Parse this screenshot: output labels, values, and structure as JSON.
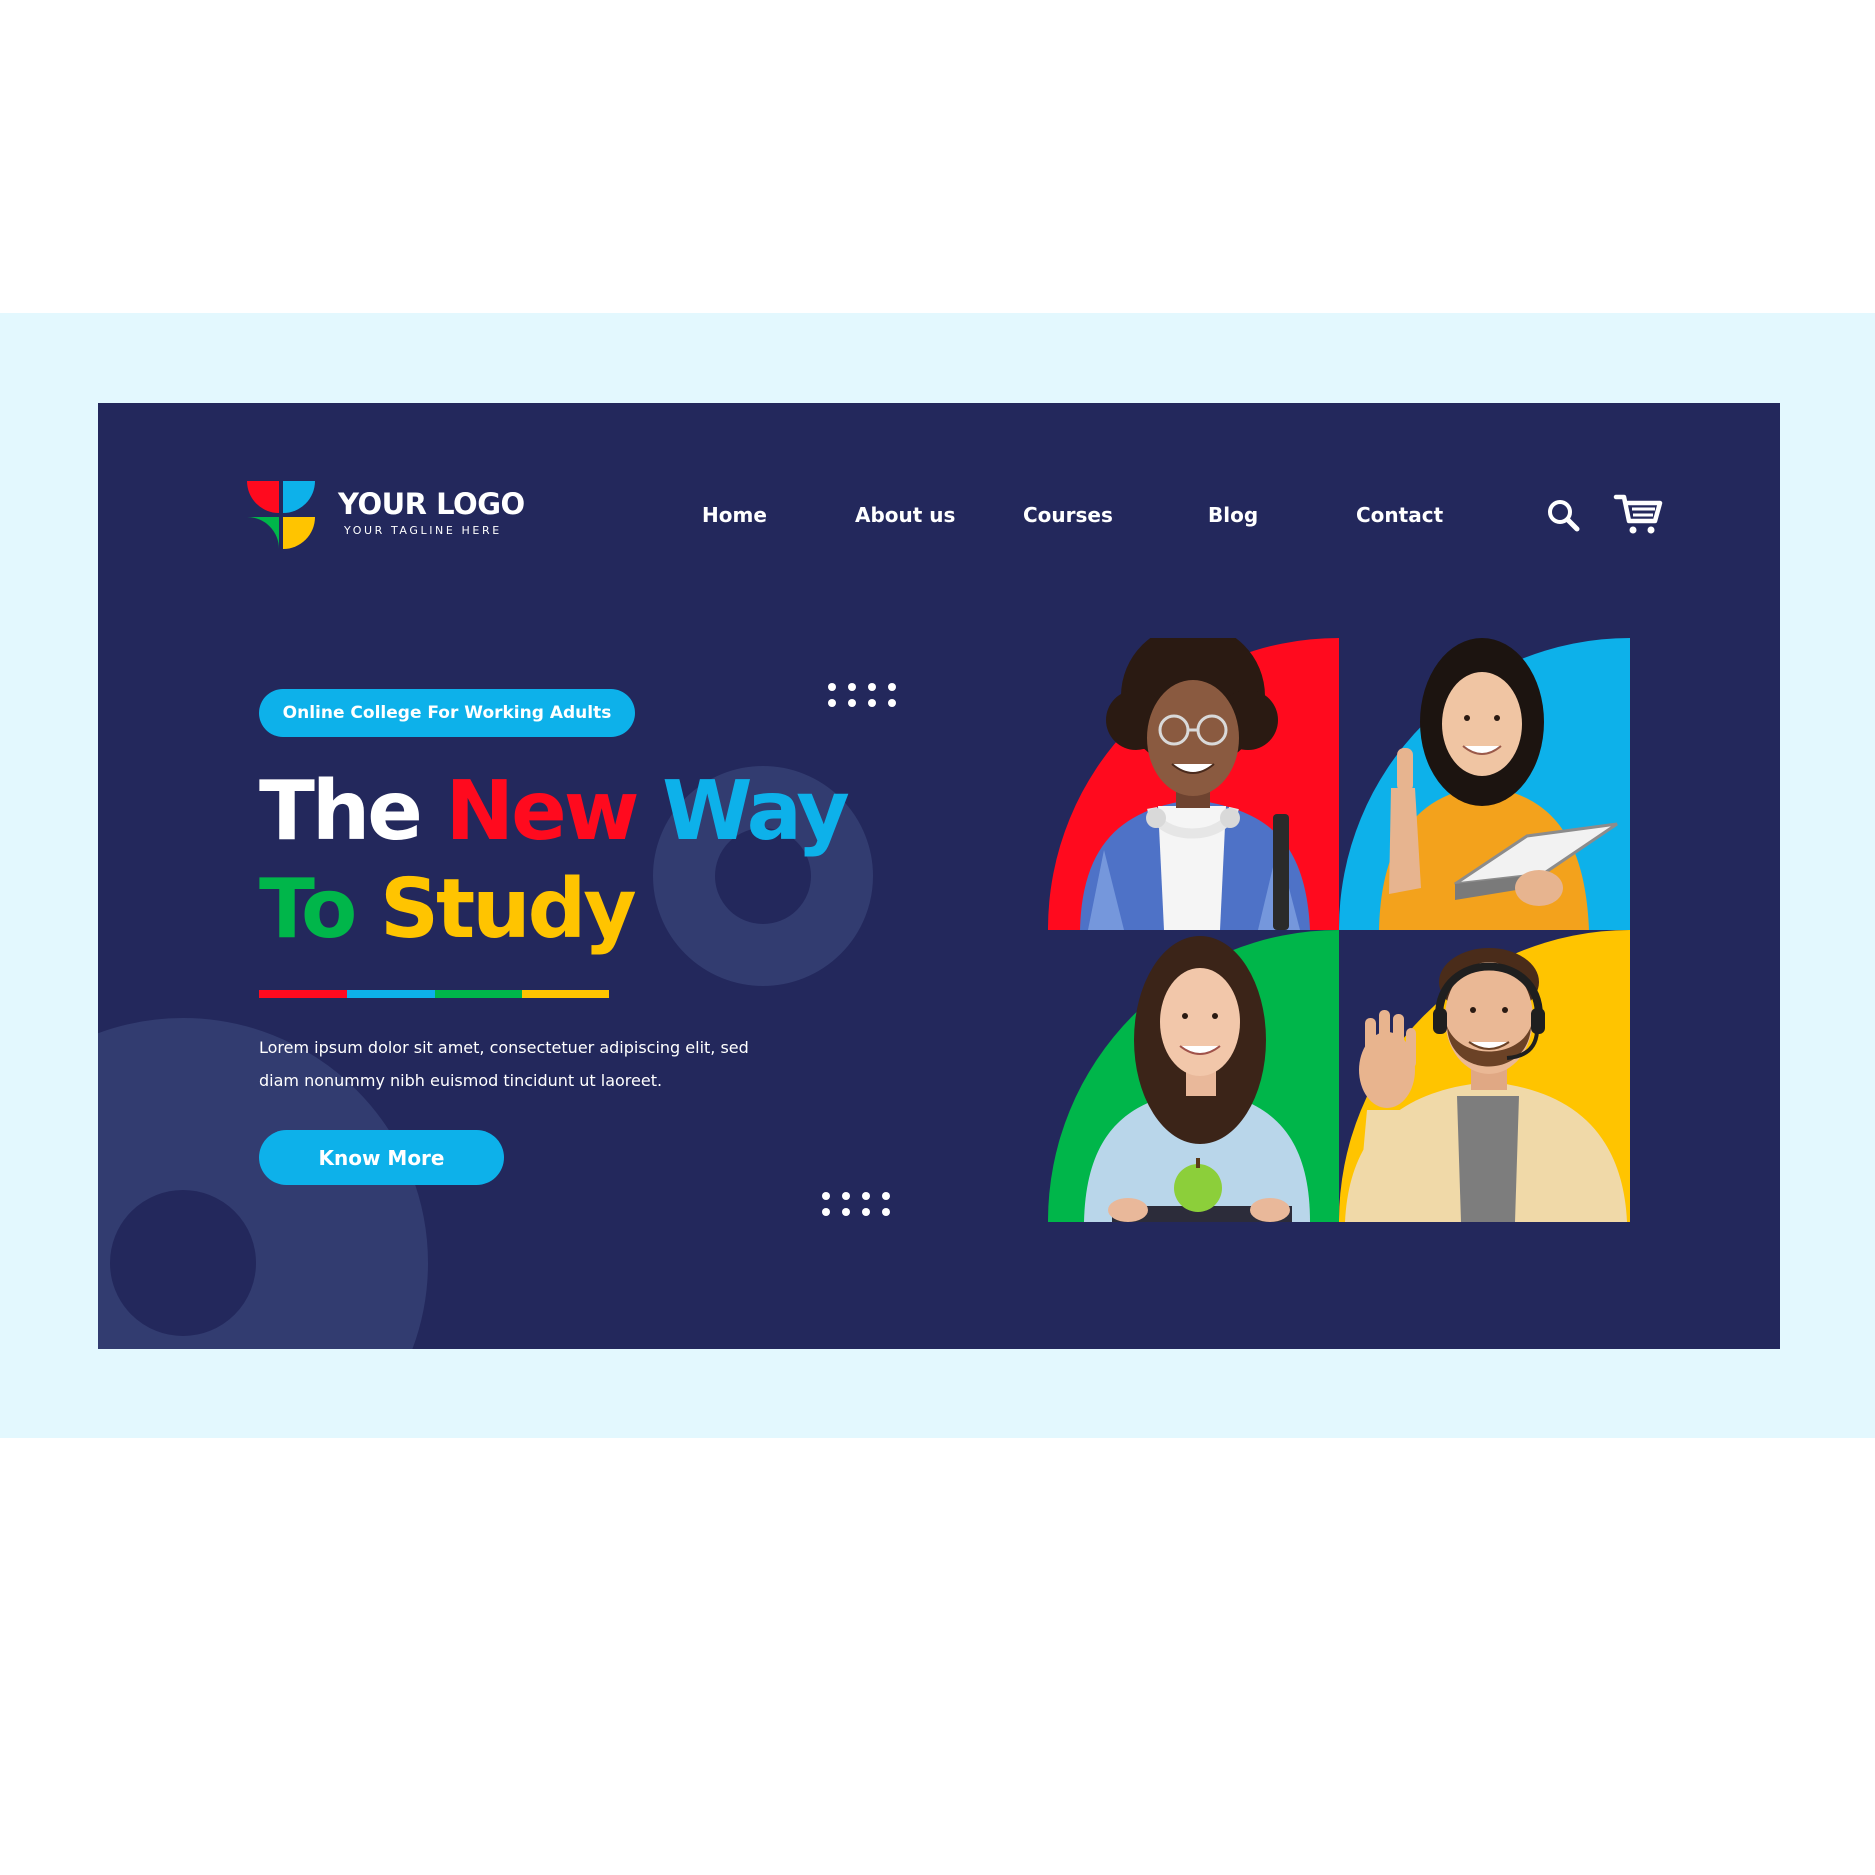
{
  "logo": {
    "title": "YOUR LOGO",
    "tagline": "YOUR TAGLINE HERE",
    "colors": [
      "#ff0a1e",
      "#0db1ea",
      "#00b64a",
      "#ffc400"
    ]
  },
  "nav": {
    "items": [
      "Home",
      "About us",
      "Courses",
      "Blog",
      "Contact"
    ],
    "search_icon": "search-icon",
    "cart_icon": "cart-icon"
  },
  "hero": {
    "badge": "Online College For Working Adults",
    "headline": {
      "word1": "The",
      "word2": "New",
      "word3": "Way",
      "word4": "To",
      "word5": "Study"
    },
    "description": "Lorem ipsum dolor sit amet, consectetuer adipiscing elit, sed diam nonummy nibh euismod tincidunt ut laoreet.",
    "cta_label": "Know More"
  },
  "photos": [
    {
      "subject": "smiling student with glasses and headphones",
      "accent": "#ff0a1e"
    },
    {
      "subject": "smiling woman holding a book giving thumbs up",
      "accent": "#0db1ea"
    },
    {
      "subject": "smiling woman holding an apple",
      "accent": "#00b64a"
    },
    {
      "subject": "smiling man with headset waving",
      "accent": "#ffc400"
    }
  ],
  "colors": {
    "background": "#23285c",
    "outer_band": "#e3f8fe",
    "red": "#ff0a1e",
    "blue": "#0db1ea",
    "green": "#00b64a",
    "yellow": "#ffc400",
    "decor": "#323c70"
  }
}
